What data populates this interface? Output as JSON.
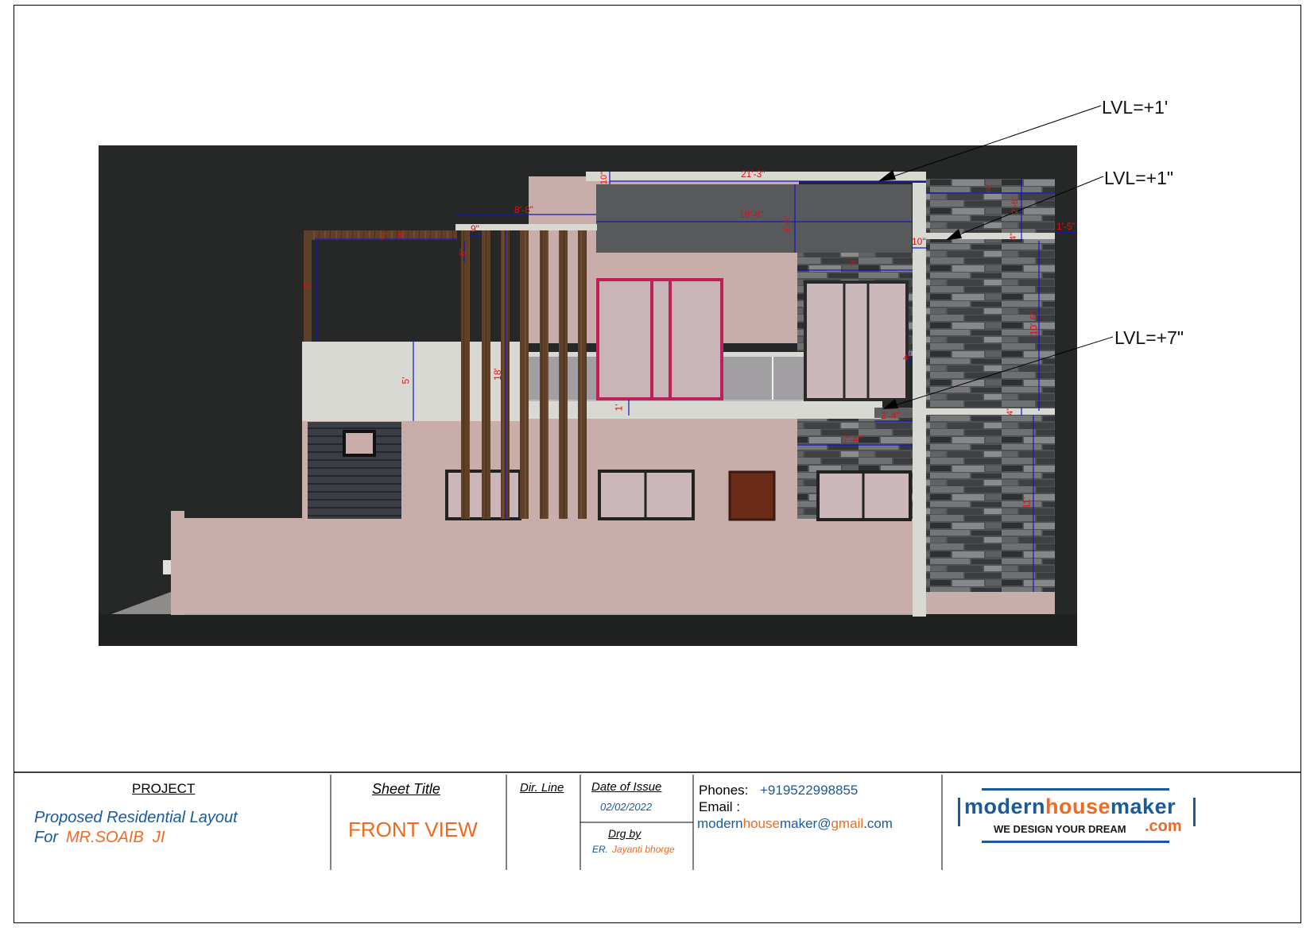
{
  "levels": [
    "LVL=+1'",
    "LVL=+1\"",
    "LVL=+7\""
  ],
  "dimensions": [
    "21'-3\"",
    "10\"",
    "8'",
    "8'-8\"",
    "19'-8\"",
    "4'-6\"",
    "2'-6\"",
    "1'-5\"",
    "4\"",
    "10\"",
    "9\"",
    "9'",
    "8\"",
    "7'",
    "6\"",
    "7'",
    "5'",
    "18'",
    "10'-6\"",
    "4\"",
    "1'",
    "2'-4\"",
    "4\"",
    "7'-4\"",
    "11'"
  ],
  "title_block": {
    "project_label": "PROJECT",
    "project_line1": "Proposed Residential Layout",
    "project_line2_prefix": "For",
    "project_line2_client": "MR.SOAIB  JI",
    "sheet_title_label": "Sheet Title",
    "sheet_title_value": "FRONT VIEW",
    "dir_line_label": "Dir. Line",
    "date_label": "Date of Issue",
    "date_value": "02/02/2022",
    "drg_by_label": "Drg by",
    "drg_by_prefix": "ER.",
    "drg_by_name": "Jayanti bhorge",
    "phones_label": "Phones:",
    "phones_value": "+919522998855",
    "email_label": "Email :",
    "email_part1": "modern",
    "email_part2": "house",
    "email_part3": "maker@",
    "email_part4": "gmail",
    "email_part5": ".com",
    "logo_part1": "modern",
    "logo_part2": "house",
    "logo_part3": "maker",
    "logo_tagline": "WE DESIGN YOUR DREAM",
    "logo_com": ".com"
  },
  "colors": {
    "background_dark": "#262828",
    "wall_pink": "#c8adab",
    "slab_white": "#d9d9d4",
    "wood": "#5e4028",
    "stone": "#56585a",
    "dimension_blue": "#1414c8",
    "dimension_red": "#e01010",
    "title_blue": "#1a5a9a",
    "title_orange": "#ee6a22"
  }
}
